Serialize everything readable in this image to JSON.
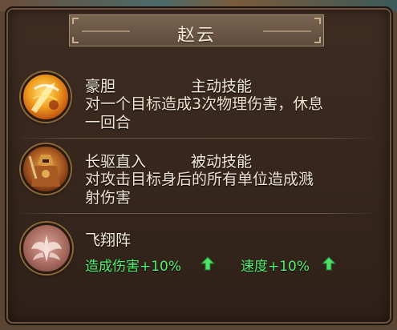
{
  "title": "赵云",
  "skills": [
    {
      "name": "豪胆",
      "type": "主动技能",
      "desc_line1": "对一个目标造成3次物理伤害，休息",
      "desc_line2": "一回合",
      "icon": "sword-slash-icon"
    },
    {
      "name": "长驱直入",
      "type": "被动技能",
      "desc_line1": "对攻击目标身后的所有单位造成溅",
      "desc_line2": "射伤害",
      "icon": "armored-warrior-icon"
    }
  ],
  "formation": {
    "name": "飞翔阵",
    "icon": "wings-emblem-icon",
    "bonuses": [
      {
        "label": "造成伤害+10%",
        "icon": "up-arrow-icon"
      },
      {
        "label": "速度+10%",
        "icon": "up-arrow-icon"
      }
    ]
  },
  "colors": {
    "bonus_green": "#52f070",
    "text_cream": "#f3ead8",
    "panel_dark": "#2f2119"
  }
}
